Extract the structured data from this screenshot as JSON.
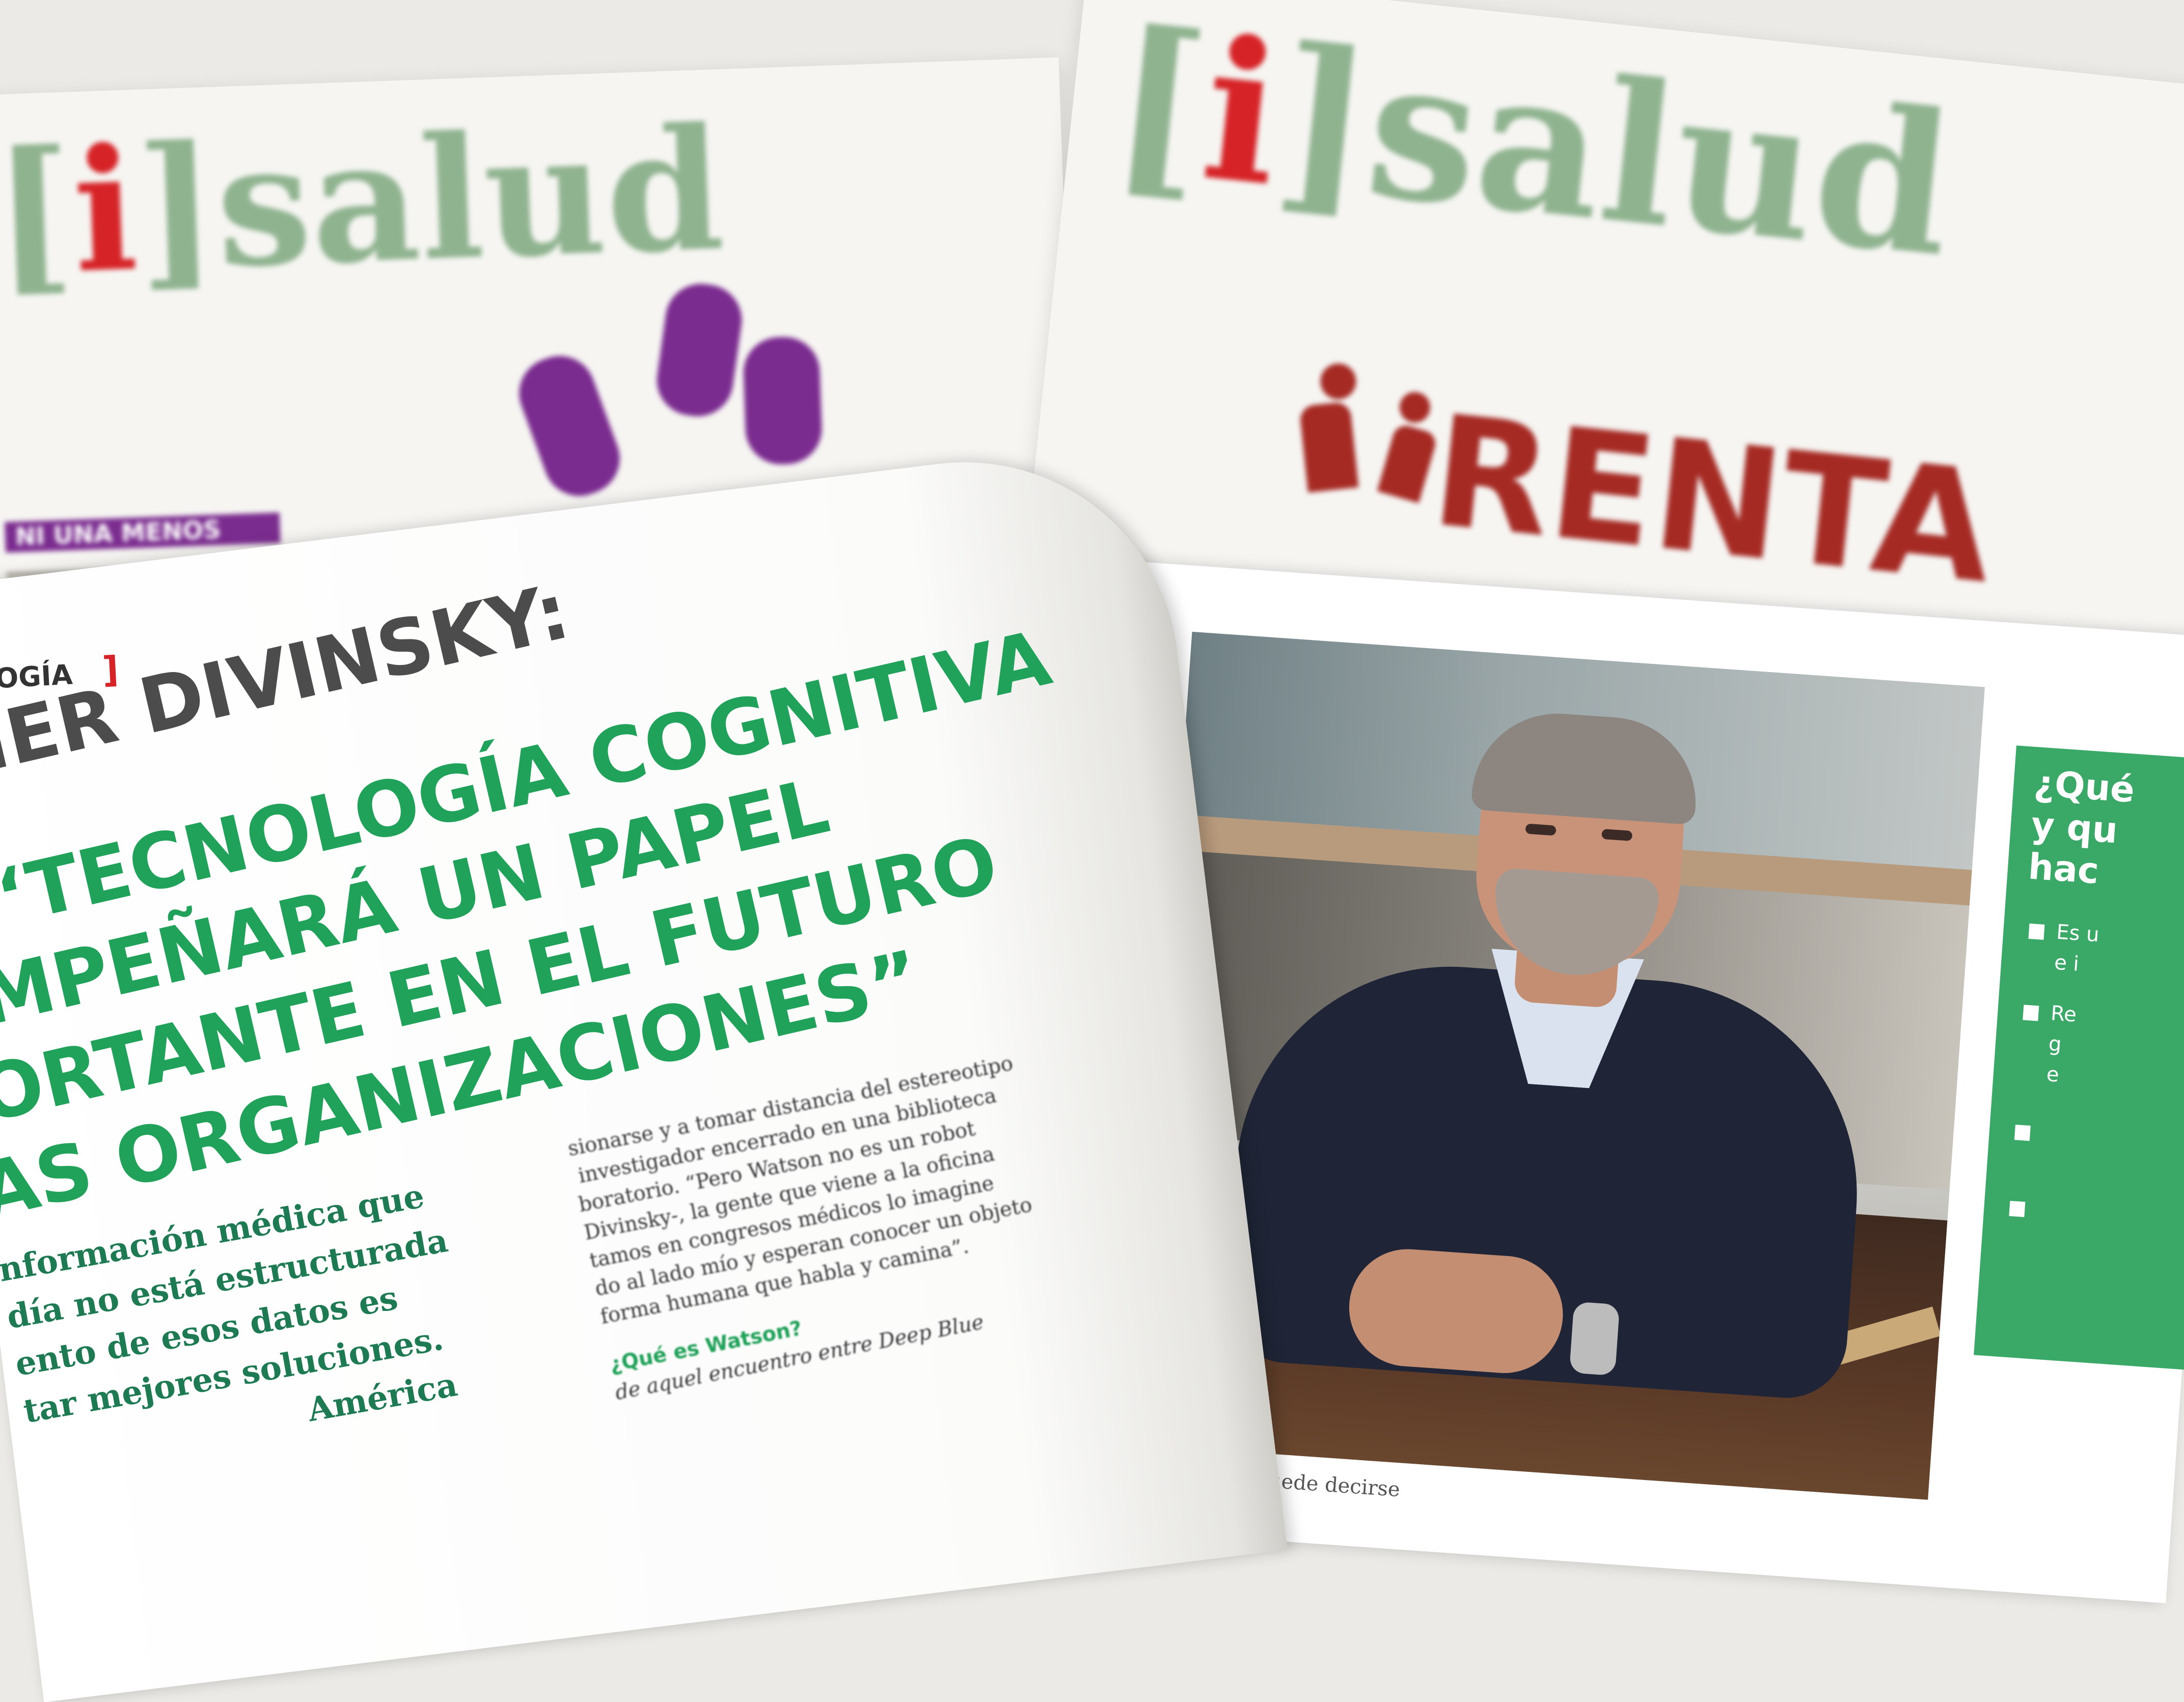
{
  "magazine": {
    "masthead_open": "[",
    "masthead_i": "i",
    "masthead_close": "]",
    "masthead_word": "salud",
    "left_banner": "NI UNA MENOS",
    "right_headline_partial": "RENTA"
  },
  "article": {
    "section": "OGÍA",
    "section_bracket": "]",
    "name_line": "IER DIVINSKY:",
    "headline_lines": [
      "TECNOLOGÍA COGNITIVA",
      "MPEÑARÁ UN PAPEL",
      "ORTANTE EN EL FUTURO",
      "AS ORGANIZACIONES”"
    ],
    "headline_quote_open": "“",
    "intro_lines": [
      "nformación médica que",
      "día no está estructurada",
      "ento de esos datos es",
      "tar mejores soluciones.",
      "América"
    ],
    "body_lines": [
      "sionarse y a tomar distancia del estereotipo",
      "investigador encerrado en una biblioteca",
      "boratorio. “Pero Watson no es un robot",
      "Divinsky-, la gente que viene a la oficina",
      "tamos en congresos médicos lo imagine",
      "do al lado mío y esperan conocer un objeto",
      "forma humana que habla y camina”."
    ],
    "subhead": "¿Qué es Watson?",
    "subhead_body": "de aquel encuentro entre Deep Blue",
    "caption": "todo lo que puede decirse"
  },
  "sidebar": {
    "title_lines": [
      "¿Qué",
      "y qu",
      "hac"
    ],
    "items": [
      "Es u",
      "e i",
      "Re",
      "g",
      "e"
    ]
  },
  "colors": {
    "green": "#21a25a",
    "masthead_green": "#8fb38f",
    "masthead_red": "#d62327",
    "banner_purple": "#7b2c8f"
  }
}
